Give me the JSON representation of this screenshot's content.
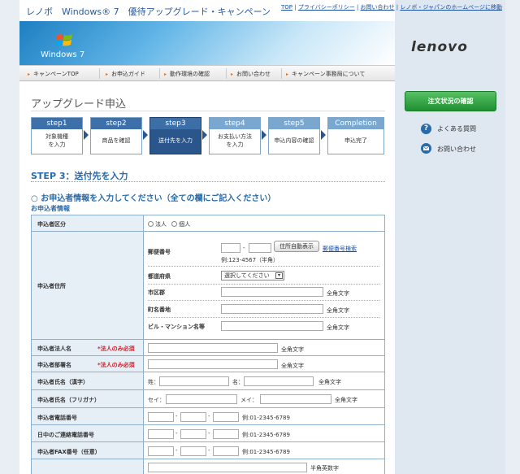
{
  "header": {
    "title": "レノボ　Windows® 7　優待アップグレード・キャンペーン",
    "links": [
      "TOP",
      "プライバシーポリシー",
      "お問い合わせ",
      "レノボ・ジャパンのホームページに移動"
    ]
  },
  "banner": {
    "logo_text": "Windows 7"
  },
  "nav": [
    "キャンペーンTOP",
    "お申込ガイド",
    "動作環境の確認",
    "お問い合わせ",
    "キャンペーン事務局について"
  ],
  "page_title": "アップグレード申込",
  "steps": [
    {
      "label": "step1",
      "desc1": "対象機種",
      "desc2": "を入力",
      "state": "done"
    },
    {
      "label": "step2",
      "desc1": "商品を確認",
      "desc2": "",
      "state": "done"
    },
    {
      "label": "step3",
      "desc1": "送付先を入力",
      "desc2": "",
      "state": "active"
    },
    {
      "label": "step4",
      "desc1": "お支払い方法",
      "desc2": "を入力",
      "state": "todo"
    },
    {
      "label": "step5",
      "desc1": "申込内容の確認",
      "desc2": "",
      "state": "todo"
    },
    {
      "label": "Completion",
      "desc1": "申込完了",
      "desc2": "",
      "state": "todo"
    }
  ],
  "section_title": "STEP 3：送付先を入力",
  "instruction": "○ お申込者情報を入力してください（全ての欄にご記入ください）",
  "subheading": "お申込者情報",
  "form": {
    "applicant_type": {
      "label": "申込者区分",
      "opt1": "法人",
      "opt2": "個人"
    },
    "address": {
      "label": "申込者住所",
      "postal_label": "郵便番号",
      "postal_dash": "-",
      "auto_button": "住所自動表示",
      "postal_search": "郵便番号検索",
      "postal_example": "例:123-4567（半角）",
      "pref_label": "都道府県",
      "pref_value": "選択してください",
      "pref_arrow": "▾",
      "city_label": "市区郡",
      "town_label": "町名番地",
      "building_label": "ビル・マンション名等",
      "fullwidth": "全角文字"
    },
    "corp_name": {
      "label": "申込者法人名",
      "required": "*法人のみ必須",
      "note": "全角文字"
    },
    "dept_name": {
      "label": "申込者部署名",
      "required": "*法人のみ必須",
      "note": "全角文字"
    },
    "name_kanji": {
      "label": "申込者氏名（漢字）",
      "last": "姓：",
      "first": "名：",
      "note": "全角文字"
    },
    "name_kana": {
      "label": "申込者氏名（フリガナ）",
      "last": "セイ：",
      "first": "メイ：",
      "note": "全角文字"
    },
    "phone": {
      "label": "申込者電話番号",
      "example": "例:01-2345-6789",
      "dash": "-"
    },
    "day_phone": {
      "label": "日中のご連絡電話番号",
      "example": "例:01-2345-6789",
      "dash": "-"
    },
    "fax": {
      "label": "申込者FAX番号（任意）",
      "example": "例:01-2345-6789",
      "dash": "-"
    },
    "last_note": "半角英数字"
  },
  "sidebar": {
    "brand": "lenovo",
    "order_status_button": "注文状況の確認",
    "faq_icon_char": "?",
    "faq": "よくある質問",
    "contact": "お問い合わせ"
  }
}
